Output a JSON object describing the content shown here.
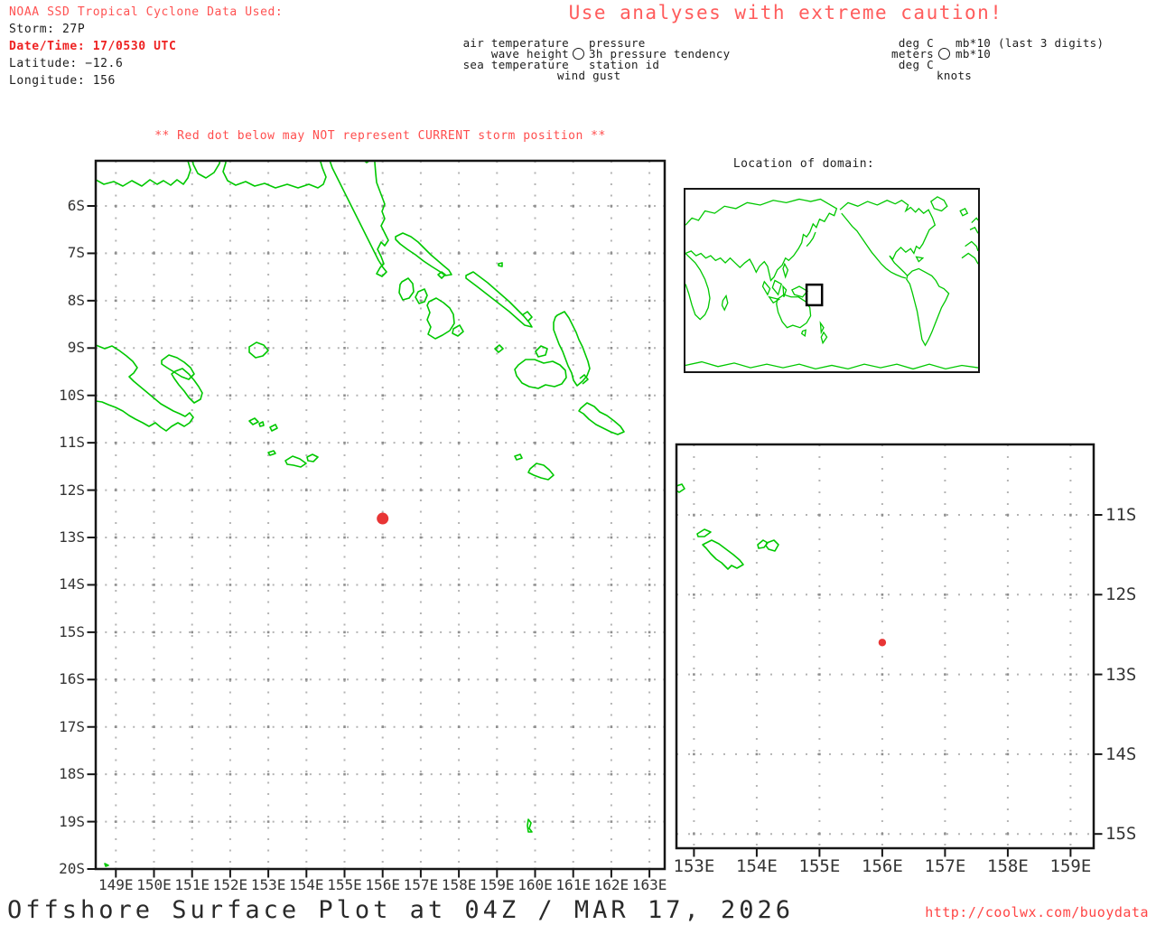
{
  "header": {
    "noaa_line": "NOAA SSD Tropical Cyclone Data Used:",
    "storm": "Storm: 27P",
    "datetime": "Date/Time: 17/0530 UTC",
    "latitude": "Latitude: −12.6",
    "longitude": "Longitude: 156",
    "caution": "Use analyses with extreme caution!"
  },
  "station_legend": {
    "left": [
      "air temperature",
      "wave height",
      "sea temperature"
    ],
    "right": [
      "pressure",
      "3h pressure tendency",
      "station id"
    ],
    "bottom": "wind gust",
    "units_left": [
      "deg C",
      "meters",
      "deg C"
    ],
    "units_right": [
      "mb*10 (last 3 digits)",
      "mb*10"
    ],
    "units_bottom": "knots",
    "circle_icon": "station-circle"
  },
  "warning": "** Red dot below may NOT represent CURRENT storm position **",
  "main_map": {
    "x_ticks": [
      "149E",
      "150E",
      "151E",
      "152E",
      "153E",
      "154E",
      "155E",
      "156E",
      "157E",
      "158E",
      "159E",
      "160E",
      "161E",
      "162E",
      "163E"
    ],
    "y_ticks": [
      "6S",
      "7S",
      "8S",
      "9S",
      "10S",
      "11S",
      "12S",
      "13S",
      "14S",
      "15S",
      "16S",
      "17S",
      "18S",
      "19S",
      "20S"
    ],
    "storm_dot": {
      "lon": 156,
      "lat": -12.6
    }
  },
  "domain_map": {
    "title": "Location of domain:"
  },
  "zoom_map": {
    "x_ticks": [
      "153E",
      "154E",
      "155E",
      "156E",
      "157E",
      "158E",
      "159E"
    ],
    "y_ticks": [
      "11S",
      "12S",
      "13S",
      "14S",
      "15S"
    ],
    "storm_dot": {
      "lon": 156,
      "lat": -12.6
    }
  },
  "footer": {
    "title": "Offshore Surface Plot at 04Z / MAR 17, 2026",
    "url": "http://coolwx.com/buoydata"
  },
  "colors": {
    "coast_green": "#00c800",
    "storm_red": "#e83535",
    "grid_gray": "#b4b4b4",
    "grid_cross_gray": "#8e8e8e",
    "border_black": "#161616"
  },
  "chart_data": {
    "type": "scatter",
    "title": "Offshore Surface Plot at 04Z / MAR 17, 2026",
    "points": [
      {
        "name": "storm-27P",
        "lon": 156,
        "lat": -12.6
      }
    ],
    "main_panel": {
      "xlim": [
        149,
        163
      ],
      "ylim": [
        -20,
        -6
      ],
      "x_unit": "E",
      "y_unit": "S",
      "grid": true
    },
    "inset_panel": {
      "xlim": [
        153,
        159
      ],
      "ylim": [
        -15,
        -11
      ],
      "x_unit": "E",
      "y_unit": "S",
      "grid": true
    },
    "legend_position": "top-center"
  }
}
